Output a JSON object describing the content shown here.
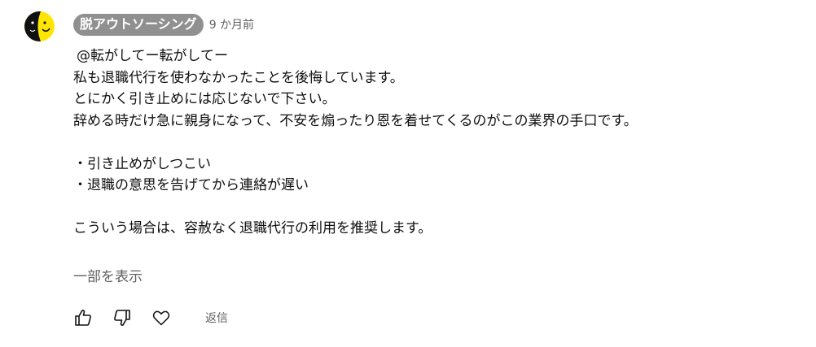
{
  "comment": {
    "author": "脱アウトソーシング",
    "timestamp": "9 か月前",
    "lines": [
      "@転がしてー転がしてー",
      "私も退職代行を使わなかったことを後悔しています。",
      "とにかく引き止めには応じないで下さい。",
      "辞める時だけ急に親身になって、不安を煽ったり恩を着せてくるのがこの業界の手口です。",
      "",
      "・引き止めがしつこい",
      "・退職の意思を告げてから連絡が遅い",
      "",
      "こういう場合は、容赦なく退職代行の利用を推奨します。"
    ],
    "show_more_label": "一部を表示"
  },
  "actions": {
    "like_icon": "thumbs-up-icon",
    "dislike_icon": "thumbs-down-icon",
    "heart_icon": "heart-icon",
    "reply_label": "返信"
  },
  "avatar": {
    "icon": "half-moon-face-avatar",
    "colors": {
      "dark": "#111111",
      "light": "#ffe600"
    }
  }
}
